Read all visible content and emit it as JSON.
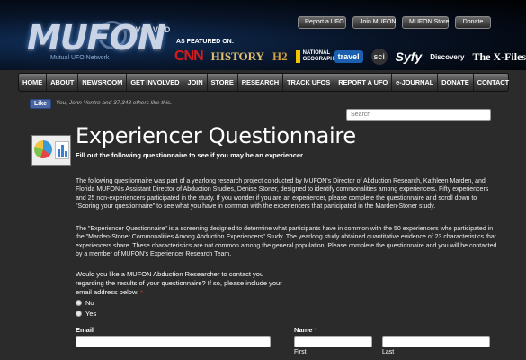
{
  "header": {
    "logo_text": "MUFON",
    "logo_tag": "EVOLVED",
    "logo_sub": "Mutual UFO Network",
    "top_links": [
      "Report a UFO",
      "Join MUFON",
      "MUFON Store",
      "Donate"
    ],
    "featured_label": "AS FEATURED ON:",
    "brands": [
      "CNN",
      "HISTORY",
      "H2",
      "NATIONAL GEOGRAPHIC",
      "travel",
      "sci",
      "Syfy",
      "Discovery",
      "The X-Files"
    ]
  },
  "nav": {
    "items": [
      "HOME",
      "ABOUT",
      "NEWSROOM",
      "GET INVOLVED",
      "JOIN",
      "STORE",
      "RESEARCH",
      "TRACK UFOS",
      "REPORT A UFO",
      "e-JOURNAL",
      "DONATE",
      "CONTACT"
    ]
  },
  "social": {
    "like_label": "Like",
    "like_text": "You, John Ventre and 37,348 others like this."
  },
  "search": {
    "placeholder": "Search"
  },
  "page": {
    "title": "Experiencer Questionnaire",
    "subtitle": "Fill out the following questionnaire to see if you may be an experiencer",
    "paragraph1": "The following questionnaire was part of a yearlong research project conducted by MUFON's Director of Abduction Research, Kathleen Marden, and Florida MUFON's Assistant Director of Abduction Studies, Denise Stoner, designed to identify commonalities among experiencers. Fifty experiencers and 25 non-experiencers participated in the study. If you wonder if you are an experiencer, please complete the questionnaire and scroll down to \"Scoring your questionnaire\" to see what you have in common with the experiencers that participated in the Marden-Stoner study.",
    "paragraph2": "The \"Experiencer Questionnaire\" is a screening designed to determine what participants have in common with the 50 experiencers who participated in the \"Marden-Stoner Commonalities Among Abduction Experiencers\" Study. The yearlong study obtained quantitative evidence of 23 characteristics that experiencers share. These characteristics are not common among the general population. Please complete the questionnaire and you will be contacted by a member of MUFON's Experiencer Research Team."
  },
  "form": {
    "question": "Would you like a MUFON Abduction Researcher to contact you regarding the results of your questionnaire? If so, please include your email address below.",
    "required_mark": "*",
    "options": [
      "No",
      "Yes"
    ],
    "email_label": "Email",
    "name_label": "Name",
    "first_label": "First",
    "last_label": "Last"
  },
  "colors": {
    "background": "#2b2b2b",
    "nav": "#4a4a4a",
    "required": "#dd3333",
    "facebook": "#4a66a0"
  }
}
